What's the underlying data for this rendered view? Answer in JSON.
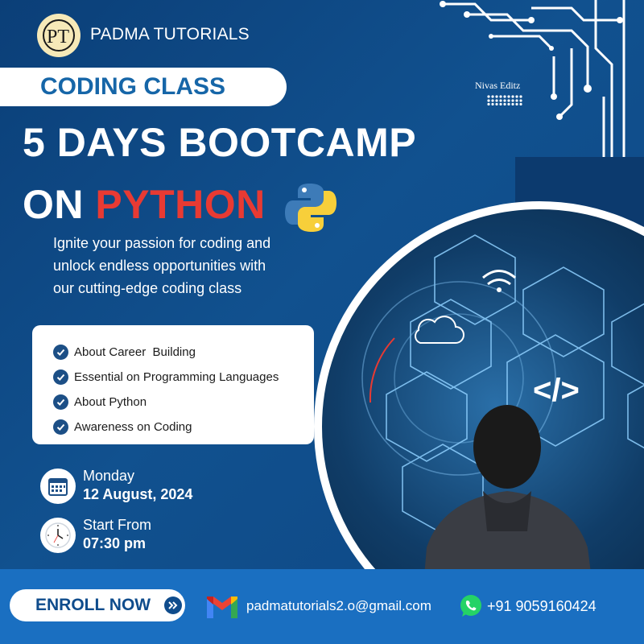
{
  "brand": {
    "name": "PADMA TUTORIALS",
    "logo_icon": "pt-monogram-icon"
  },
  "banner": {
    "label": "CODING CLASS"
  },
  "watermark": {
    "text": "Nivas Editz"
  },
  "headline": {
    "line1": "5 DAYS BOOTCAMP",
    "line2_prefix": "ON ",
    "line2_highlight": "PYTHON"
  },
  "tagline": {
    "lines": [
      "Ignite your passion for coding and",
      "unlock endless opportunities with",
      "our cutting-edge coding class"
    ]
  },
  "topics": [
    "About Career  Building",
    "Essential on Programming Languages",
    "About Python",
    "Awareness on Coding"
  ],
  "schedule": {
    "day": "Monday",
    "date": "12 August, 2024",
    "start_label": "Start From",
    "start_time": "07:30 pm"
  },
  "footer": {
    "cta": "ENROLL NOW",
    "email": "padmatutorials2.o@gmail.com",
    "phone": "+91 9059160424"
  },
  "colors": {
    "background": "#0f4c8c",
    "accent_red": "#e83a33",
    "footer_blue": "#1a6fc1",
    "banner_text": "#1666a8",
    "check_blue": "#1c4f86"
  }
}
